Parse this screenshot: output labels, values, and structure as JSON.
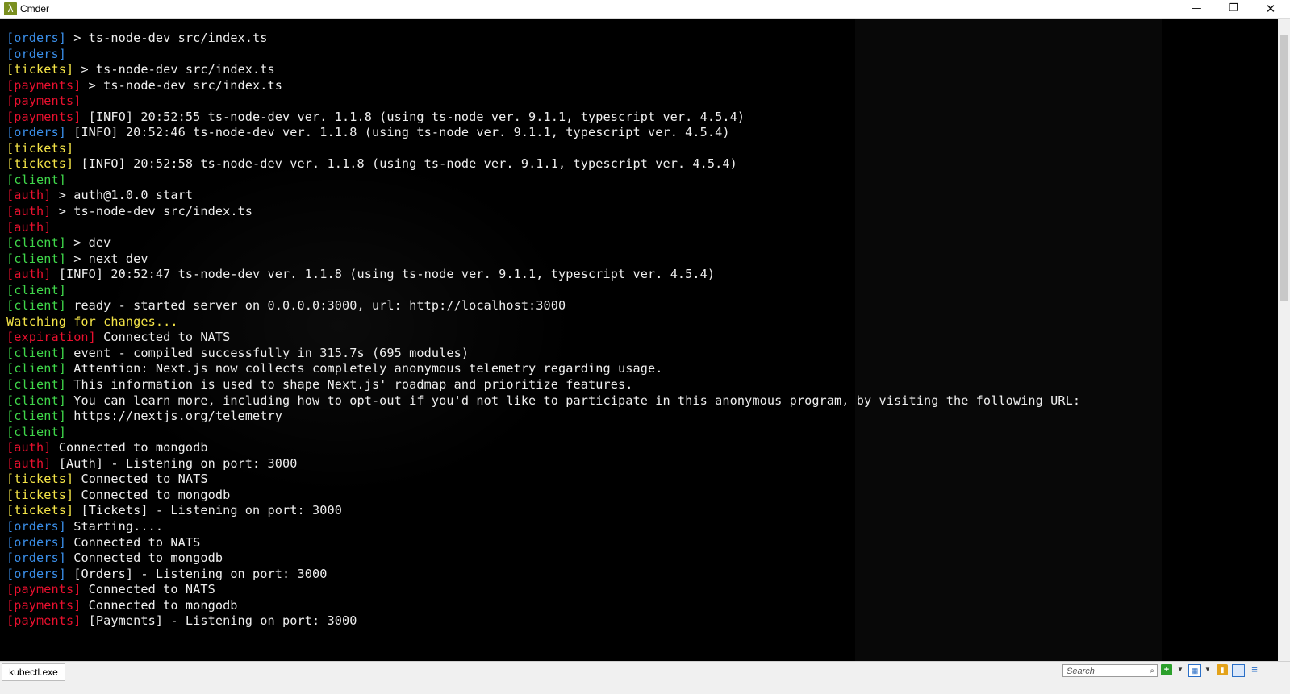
{
  "window": {
    "title": "Cmder",
    "icon": "lambda-icon",
    "icon_glyph": "λ",
    "minimize_glyph": "—",
    "maximize_glyph": "❐",
    "close_glyph": "✕"
  },
  "colors": {
    "orders": "#3a8ee8",
    "payments": "#e8102e",
    "auth": "#e8102e",
    "expiration": "#e8102e",
    "tickets": "#f4e447",
    "client": "#3fd64a",
    "text": "#eeeeee"
  },
  "terminal": {
    "lines": [
      {
        "tag": "[orders]",
        "color": "blue",
        "text": " > ts-node-dev src/index.ts"
      },
      {
        "tag": "[orders]",
        "color": "blue",
        "text": ""
      },
      {
        "tag": "[tickets]",
        "color": "yellow",
        "text": " > ts-node-dev src/index.ts"
      },
      {
        "tag": "[payments]",
        "color": "red",
        "text": " > ts-node-dev src/index.ts"
      },
      {
        "tag": "[payments]",
        "color": "red",
        "text": ""
      },
      {
        "tag": "[payments]",
        "color": "red",
        "text": " [INFO] 20:52:55 ts-node-dev ver. 1.1.8 (using ts-node ver. 9.1.1, typescript ver. 4.5.4)"
      },
      {
        "tag": "[orders]",
        "color": "blue",
        "text": " [INFO] 20:52:46 ts-node-dev ver. 1.1.8 (using ts-node ver. 9.1.1, typescript ver. 4.5.4)"
      },
      {
        "tag": "[tickets]",
        "color": "yellow",
        "text": ""
      },
      {
        "tag": "[tickets]",
        "color": "yellow",
        "text": " [INFO] 20:52:58 ts-node-dev ver. 1.1.8 (using ts-node ver. 9.1.1, typescript ver. 4.5.4)"
      },
      {
        "tag": "[client]",
        "color": "green",
        "text": ""
      },
      {
        "tag": "[auth]",
        "color": "red",
        "text": " > auth@1.0.0 start"
      },
      {
        "tag": "[auth]",
        "color": "red",
        "text": " > ts-node-dev src/index.ts"
      },
      {
        "tag": "[auth]",
        "color": "red",
        "text": ""
      },
      {
        "tag": "[client]",
        "color": "green",
        "text": " > dev"
      },
      {
        "tag": "[client]",
        "color": "green",
        "text": " > next dev"
      },
      {
        "tag": "[auth]",
        "color": "red",
        "text": " [INFO] 20:52:47 ts-node-dev ver. 1.1.8 (using ts-node ver. 9.1.1, typescript ver. 4.5.4)"
      },
      {
        "tag": "[client]",
        "color": "green",
        "text": ""
      },
      {
        "tag": "[client]",
        "color": "green",
        "text": " ready - started server on 0.0.0.0:3000, url: http://localhost:3000"
      },
      {
        "tag": "",
        "color": "yellow",
        "text": "Watching for changes..."
      },
      {
        "tag": "[expiration]",
        "color": "red",
        "text": " Connected to NATS"
      },
      {
        "tag": "[client]",
        "color": "green",
        "text": " event - compiled successfully in 315.7s (695 modules)"
      },
      {
        "tag": "[client]",
        "color": "green",
        "text": " Attention: Next.js now collects completely anonymous telemetry regarding usage."
      },
      {
        "tag": "[client]",
        "color": "green",
        "text": " This information is used to shape Next.js' roadmap and prioritize features."
      },
      {
        "tag": "[client]",
        "color": "green",
        "text": " You can learn more, including how to opt-out if you'd not like to participate in this anonymous program, by visiting the following URL:"
      },
      {
        "tag": "[client]",
        "color": "green",
        "text": " https://nextjs.org/telemetry"
      },
      {
        "tag": "[client]",
        "color": "green",
        "text": ""
      },
      {
        "tag": "[auth]",
        "color": "red",
        "text": " Connected to mongodb"
      },
      {
        "tag": "[auth]",
        "color": "red",
        "text": " [Auth] - Listening on port: 3000"
      },
      {
        "tag": "[tickets]",
        "color": "yellow",
        "text": " Connected to NATS"
      },
      {
        "tag": "[tickets]",
        "color": "yellow",
        "text": " Connected to mongodb"
      },
      {
        "tag": "[tickets]",
        "color": "yellow",
        "text": " [Tickets] - Listening on port: 3000"
      },
      {
        "tag": "[orders]",
        "color": "blue",
        "text": " Starting...."
      },
      {
        "tag": "[orders]",
        "color": "blue",
        "text": " Connected to NATS"
      },
      {
        "tag": "[orders]",
        "color": "blue",
        "text": " Connected to mongodb"
      },
      {
        "tag": "[orders]",
        "color": "blue",
        "text": " [Orders] - Listening on port: 3000"
      },
      {
        "tag": "[payments]",
        "color": "red",
        "text": " Connected to NATS"
      },
      {
        "tag": "[payments]",
        "color": "red",
        "text": " Connected to mongodb"
      },
      {
        "tag": "[payments]",
        "color": "red",
        "text": " [Payments] - Listening on port: 3000"
      }
    ]
  },
  "statusbar": {
    "tab_label": "kubectl.exe",
    "search_placeholder": "Search",
    "icons": [
      "new-console-icon",
      "dropdown-icon",
      "view-switch-icon",
      "dropdown-icon",
      "lock-icon",
      "layout-icon",
      "menu-icon"
    ]
  }
}
